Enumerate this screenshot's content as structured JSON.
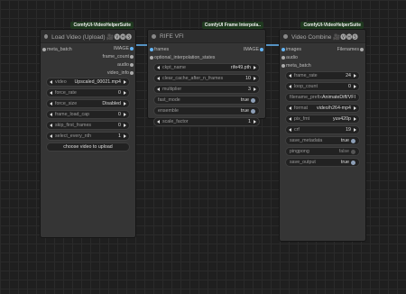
{
  "load_video": {
    "badge": "ComfyUI-VideoHelperSuite",
    "title": "Load Video (Upload) 🎥🅥🅗🅢",
    "input": "meta_batch",
    "outputs": [
      "IMAGE",
      "frame_count",
      "audio",
      "video_info"
    ],
    "widgets": [
      {
        "label": "video",
        "value": "Upscaled_00021.mp4"
      },
      {
        "label": "force_rate",
        "value": "0"
      },
      {
        "label": "force_size",
        "value": "Disabled"
      },
      {
        "label": "frame_load_cap",
        "value": "0"
      },
      {
        "label": "skip_first_frames",
        "value": "0"
      },
      {
        "label": "select_every_nth",
        "value": "1"
      }
    ],
    "upload_button": "choose video to upload"
  },
  "rife": {
    "badge": "ComfyUI Frame Interpola..",
    "title": "RIFE VFI",
    "input": "frames",
    "output": "IMAGE",
    "input2": "optional_interpolation_states",
    "widgets": [
      {
        "label": "ckpt_name",
        "value": "rife49.pth",
        "type": "combo"
      },
      {
        "label": "clear_cache_after_n_frames",
        "value": "10",
        "type": "combo"
      },
      {
        "label": "multiplier",
        "value": "3",
        "type": "combo"
      },
      {
        "label": "fast_mode",
        "value": "true",
        "type": "toggle",
        "on": true
      },
      {
        "label": "ensemble",
        "value": "true",
        "type": "toggle",
        "on": true
      },
      {
        "label": "scale_factor",
        "value": "1",
        "type": "combo"
      }
    ]
  },
  "combine": {
    "badge": "ComfyUI-VideoHelperSuite",
    "title": "Video Combine 🎥🅥🅗🅢",
    "inputs": [
      "images",
      "audio",
      "meta_batch"
    ],
    "output": "Filenames",
    "widgets": [
      {
        "label": "frame_rate",
        "value": "24",
        "type": "combo"
      },
      {
        "label": "loop_count",
        "value": "0",
        "type": "combo"
      },
      {
        "label": "filename_prefix",
        "value": "AnimateDiff/VFI",
        "type": "text"
      },
      {
        "label": "format",
        "value": "video/h264-mp4",
        "type": "combo"
      },
      {
        "label": "pix_fmt",
        "value": "yuv420p",
        "type": "combo"
      },
      {
        "label": "crf",
        "value": "19",
        "type": "combo"
      },
      {
        "label": "save_metadata",
        "value": "true",
        "type": "toggle",
        "on": true
      },
      {
        "label": "pingpong",
        "value": "false",
        "type": "toggle",
        "on": false
      },
      {
        "label": "save_output",
        "value": "true",
        "type": "toggle",
        "on": true
      }
    ]
  }
}
